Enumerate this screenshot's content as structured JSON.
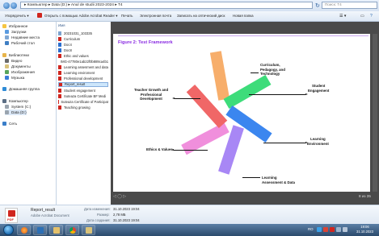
{
  "address": {
    "path": "▸ Компьютер ▸ Data (D:) ▸ Anul de studii 2023-2024 ▸ T4",
    "search_placeholder": "Поиск: T4"
  },
  "toolbar": {
    "organize": "Упорядочить ▾",
    "open_with": "Открыть с помощью Adobe Acrobat Reader ▾",
    "print": "Печать",
    "email": "Электронная почта",
    "burn": "Записать на оптический диск",
    "new_folder": "Новая папка"
  },
  "nav": {
    "favorites": "Избранное",
    "downloads": "Загрузки",
    "recent": "Недавние места",
    "desktop": "Рабочий стол",
    "libraries": "Библиотеки",
    "video": "Видео",
    "documents": "Документы",
    "pictures": "Изображения",
    "music": "Музыка",
    "homegroup": "Домашняя группа",
    "computer": "Компьютер",
    "system_c": "System (C:)",
    "data_d": "Data (D:)",
    "network": "Сеть"
  },
  "filelist": {
    "column_name": "Имя",
    "files": [
      "20231031_103335",
      "Curriculum",
      "Doc4",
      "Doc8",
      "Ethic and values",
      "IMG-47780e1ab22f0b889ca4b1",
      "Learning assesment and data",
      "Learning enviroment",
      "Professional development",
      "Report_result",
      "Student engagement",
      "Suteaza Certificate BF Medi",
      "Suteaza Certificate of Participat",
      "Teaching growing"
    ],
    "selected": "Report_result"
  },
  "slide": {
    "title": "Figure 2: Test Framework",
    "labels": {
      "curriculum": [
        "Curriculum,",
        "Pedagogy, and",
        "Technology"
      ],
      "student": [
        "Student",
        "Engagement"
      ],
      "learning_env": [
        "Learning",
        "Environment"
      ],
      "assessment": [
        "Learning",
        "Assessment & Data"
      ],
      "ethics": [
        "Ethics & Values"
      ],
      "teacher": [
        "Teacher Growth and",
        "Professional",
        "Development"
      ]
    },
    "colors": {
      "orange": "#f7ae6b",
      "green": "#3ddc7a",
      "blue": "#3b86ef",
      "purple": "#a887f5",
      "pink": "#f08fdc",
      "red": "#f06767"
    }
  },
  "preview": {
    "page_count": "8 из 35"
  },
  "details": {
    "file_name": "Report_result",
    "file_type": "Adobe Acrobat Document",
    "modified_label": "Дата изменения:",
    "modified_value": "31.10.2023 19:04",
    "size_label": "Размер:",
    "size_value": "2,78 МБ",
    "created_label": "Дата создания:",
    "created_value": "31.10.2023 19:04",
    "icon_text": "PDF"
  },
  "taskbar": {
    "lang": "RO",
    "time": "19:06",
    "date": "31.10.2023"
  }
}
